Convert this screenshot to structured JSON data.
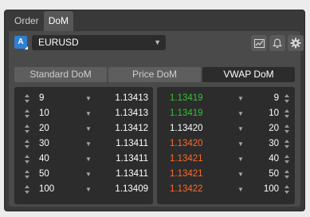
{
  "tabs": [
    {
      "label": "Order",
      "active": false
    },
    {
      "label": "DoM",
      "active": true
    }
  ],
  "toolbar": {
    "account_badge": "A",
    "symbol": "EURUSD",
    "icons": [
      "chart-icon",
      "bell-icon",
      "gear-icon"
    ]
  },
  "modes": [
    {
      "label": "Standard DoM",
      "active": false
    },
    {
      "label": "Price DoM",
      "active": false
    },
    {
      "label": "VWAP DoM",
      "active": true
    }
  ],
  "colors": {
    "bid": "#ffffff",
    "ask_green": "#35c035",
    "ask_orange": "#ff6a2b"
  },
  "bid_side": [
    {
      "qty": "9",
      "price": "1.13413"
    },
    {
      "qty": "10",
      "price": "1.13413"
    },
    {
      "qty": "20",
      "price": "1.13412"
    },
    {
      "qty": "30",
      "price": "1.13411"
    },
    {
      "qty": "40",
      "price": "1.13411"
    },
    {
      "qty": "50",
      "price": "1.13411"
    },
    {
      "qty": "100",
      "price": "1.13409"
    }
  ],
  "ask_side": [
    {
      "price": "1.13419",
      "qty": "9",
      "tone": "green"
    },
    {
      "price": "1.13419",
      "qty": "10",
      "tone": "green"
    },
    {
      "price": "1.13420",
      "qty": "20",
      "tone": "white"
    },
    {
      "price": "1.13420",
      "qty": "30",
      "tone": "orange"
    },
    {
      "price": "1.13421",
      "qty": "40",
      "tone": "orange"
    },
    {
      "price": "1.13421",
      "qty": "50",
      "tone": "orange"
    },
    {
      "price": "1.13422",
      "qty": "100",
      "tone": "orange"
    }
  ]
}
